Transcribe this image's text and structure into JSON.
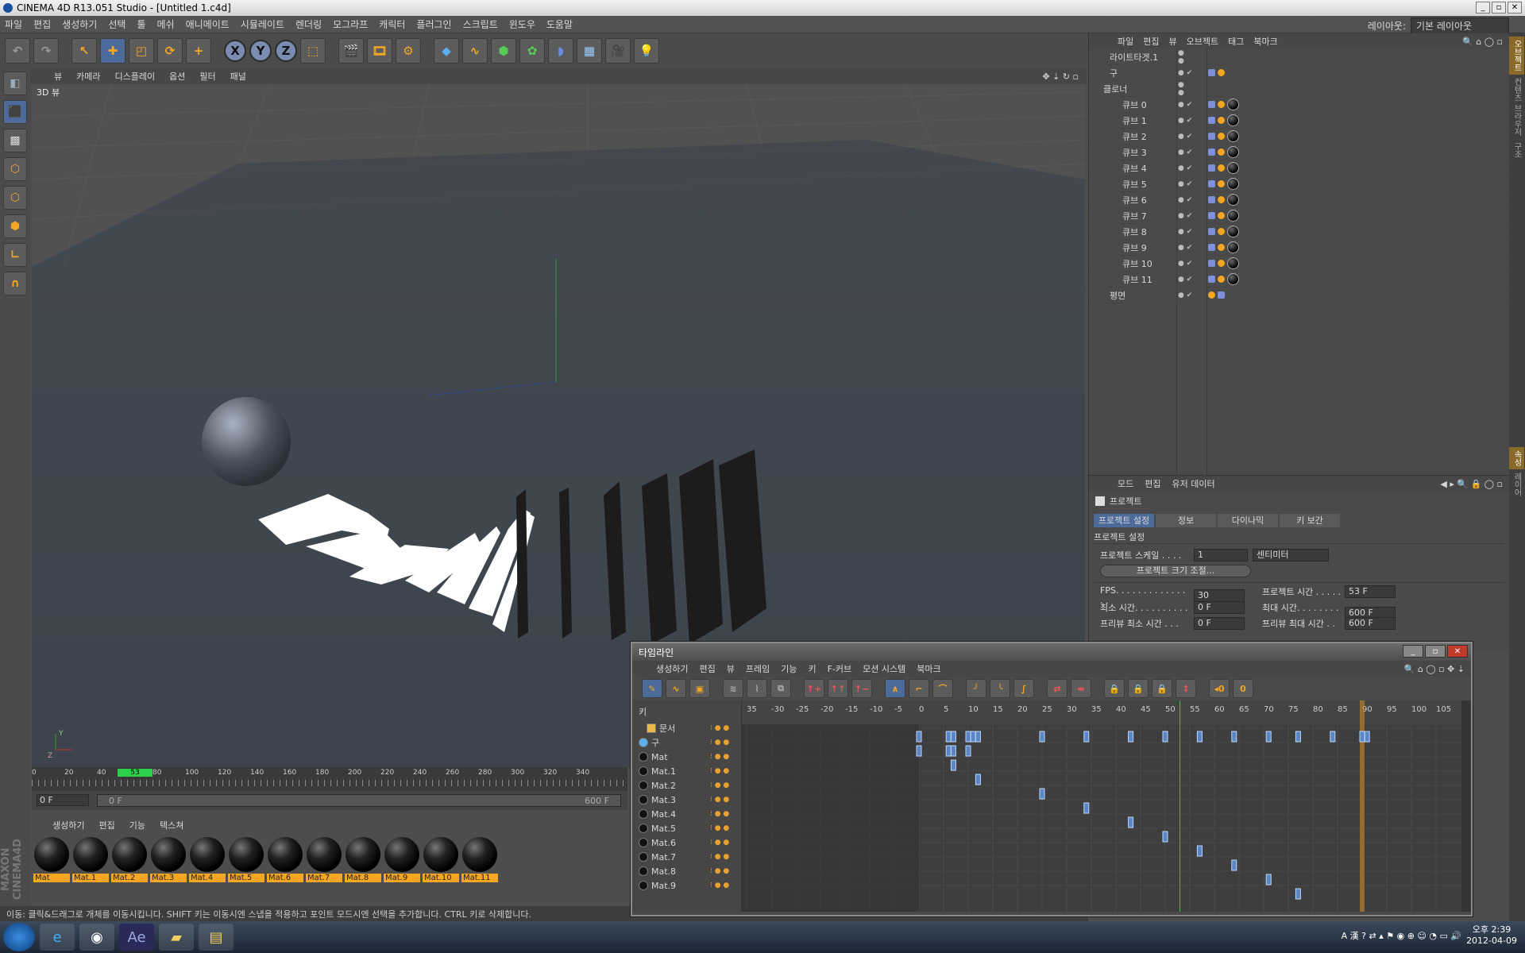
{
  "window": {
    "title": "CINEMA 4D R13.051 Studio - [Untitled 1.c4d]"
  },
  "menu": [
    "파일",
    "편집",
    "생성하기",
    "선택",
    "툴",
    "메쉬",
    "애니메이트",
    "시뮬레이트",
    "렌더링",
    "모그라프",
    "캐릭터",
    "플러그인",
    "스크립트",
    "윈도우",
    "도움말"
  ],
  "layout": {
    "label": "레이아웃:",
    "value": "기본 레이아웃"
  },
  "viewport": {
    "menu": [
      "뷰",
      "카메라",
      "디스플레이",
      "옵션",
      "필터",
      "패널"
    ],
    "label": "3D 뷰"
  },
  "time": {
    "ruler": [
      "0",
      "20",
      "40",
      "53",
      "80",
      "100",
      "120",
      "140",
      "160",
      "180",
      "200",
      "220",
      "240",
      "260",
      "280",
      "300",
      "320",
      "340"
    ],
    "current": "0 F",
    "start": "0 F",
    "end": "600 F"
  },
  "materials": {
    "menu": [
      "생성하기",
      "편집",
      "기능",
      "텍스쳐"
    ],
    "items": [
      "Mat",
      "Mat.1",
      "Mat.2",
      "Mat.3",
      "Mat.4",
      "Mat.5",
      "Mat.6",
      "Mat.7",
      "Mat.8",
      "Mat.9",
      "Mat.10",
      "Mat.11"
    ]
  },
  "brand": "MAXON CINEMA4D",
  "status": "이동: 클릭&드래그로 개체를 이동시킵니다. SHIFT 키는 이동시엔 스냅을 적용하고 포인트 모드시엔 선택을 추가합니다. CTRL 키로 삭제합니다.",
  "objects": {
    "menu": [
      "파일",
      "편집",
      "뷰",
      "오브젝트",
      "태그",
      "북마크"
    ],
    "items": [
      "라이트타겟.1",
      "구",
      "클로너",
      "큐브 0",
      "큐브 1",
      "큐브 2",
      "큐브 3",
      "큐브 4",
      "큐브 5",
      "큐브 6",
      "큐브 7",
      "큐브 8",
      "큐브 9",
      "큐브 10",
      "큐브 11",
      "평면"
    ]
  },
  "attributes": {
    "menu": [
      "모드",
      "편집",
      "유저 데이터"
    ],
    "title": "프로젝트",
    "tabs": [
      "프로젝트 설정",
      "정보",
      "다이나믹",
      "키 보간"
    ],
    "section": "프로젝트 설정",
    "scale_label": "프로젝트 스케일 . . . .",
    "scale_value": "1",
    "scale_unit": "센티미터",
    "resize_btn": "프로젝트 크기 조절...",
    "fps_label": "FPS. . . . . . . . . . . . . . .",
    "fps": "30",
    "proj_time_label": "프로젝트 시간 . . . . .",
    "proj_time": "53 F",
    "min_label": "최소 시간. . . . . . . . . .",
    "min": "0 F",
    "max_label": "최대 시간. . . . . . . . .",
    "max": "600 F",
    "pmin_label": "프리뷰 최소 시간 . . .",
    "pmin": "0 F",
    "pmax_label": "프리뷰 최대 시간 . .",
    "pmax": "600 F"
  },
  "timeline": {
    "title": "타임라인",
    "menu": [
      "생성하기",
      "편집",
      "뷰",
      "프레임",
      "기능",
      "키",
      "F-커브",
      "모션 시스템",
      "북마크"
    ],
    "key_label": "키",
    "ruler": [
      "35",
      "-30",
      "-25",
      "-20",
      "-15",
      "-10",
      "-5",
      "0",
      "5",
      "10",
      "15",
      "20",
      "25",
      "30",
      "35",
      "40",
      "45",
      "50",
      "55",
      "60",
      "65",
      "70",
      "75",
      "80",
      "85",
      "90",
      "95",
      "100",
      "105"
    ],
    "tracks": [
      "문서",
      "구",
      "Mat",
      "Mat.1",
      "Mat.2",
      "Mat.3",
      "Mat.4",
      "Mat.5",
      "Mat.6",
      "Mat.7",
      "Mat.8",
      "Mat.9"
    ]
  },
  "side_tabs": [
    "오브젝트",
    "컨텐츠 브라우저",
    "구조"
  ],
  "side_tabs2": [
    "속성",
    "레이어"
  ],
  "clock": {
    "time": "오후 2:39",
    "date": "2012-04-09"
  }
}
